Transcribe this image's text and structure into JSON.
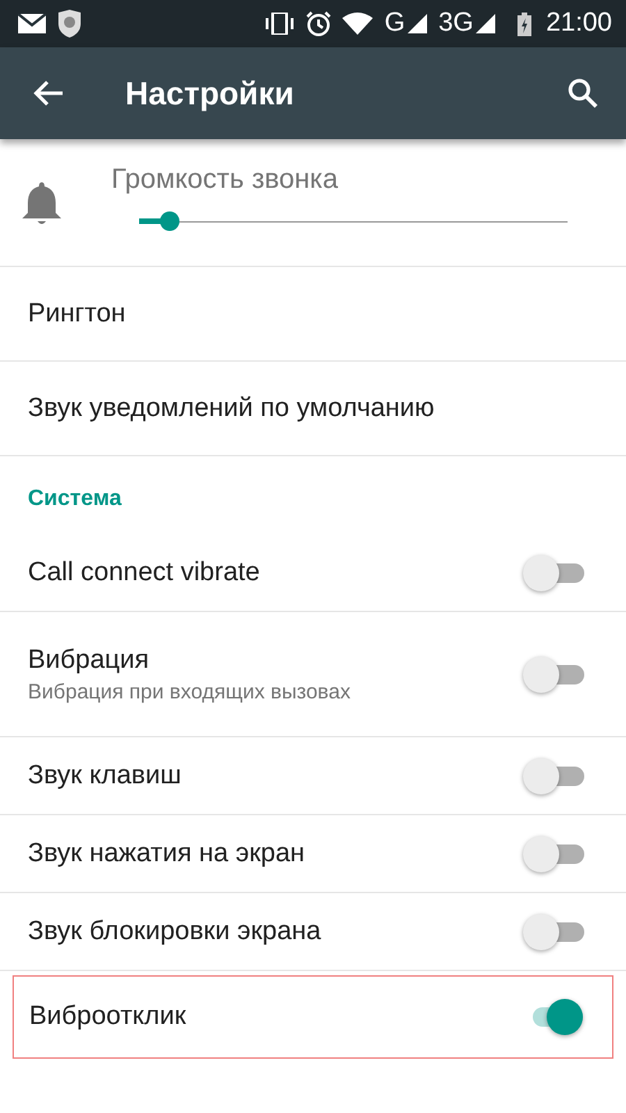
{
  "status_bar": {
    "network_1": "G",
    "network_2": "3G",
    "time": "21:00"
  },
  "app_bar": {
    "title": "Настройки"
  },
  "volume": {
    "label": "Громкость звонка",
    "level": 0.07
  },
  "items": [
    {
      "title": "Рингтон"
    },
    {
      "title": "Звук уведомлений по умолчанию"
    }
  ],
  "section": {
    "title": "Система"
  },
  "toggles": [
    {
      "title": "Call connect vibrate",
      "on": false,
      "highlighted": false
    },
    {
      "title": "Вибрация",
      "subtitle": "Вибрация при входящих вызовах",
      "on": false,
      "highlighted": false
    },
    {
      "title": "Звук клавиш",
      "on": false,
      "highlighted": false
    },
    {
      "title": "Звук нажатия на экран",
      "on": false,
      "highlighted": false
    },
    {
      "title": "Звук блокировки экрана",
      "on": false,
      "highlighted": false
    },
    {
      "title": "Виброотклик",
      "on": true,
      "highlighted": true
    }
  ]
}
